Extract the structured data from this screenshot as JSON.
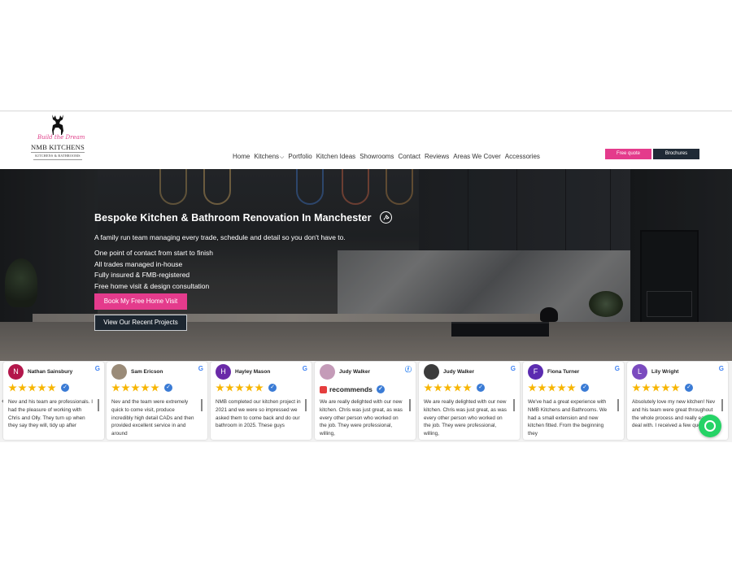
{
  "logo": {
    "script": "Build the Dream",
    "name": "NMB KITCHENS",
    "sub": "KITCHENS & BATHROOMS"
  },
  "nav": {
    "items": [
      "Home",
      "Kitchens",
      "Portfolio",
      "Kitchen Ideas",
      "Showrooms",
      "Contact",
      "Reviews",
      "Areas We Cover",
      "Accessories"
    ]
  },
  "header_buttons": {
    "free_quote": "Free quote",
    "brochures": "Brochures"
  },
  "hero": {
    "title": "Bespoke Kitchen & Bathroom Renovation In Manchester",
    "subtitle": "A family run team managing every trade, schedule and detail so you don't have to.",
    "bullets": [
      "One point of contact from start to finish",
      "All trades managed in-house",
      "Fully insured & FMB-registered",
      "Free home visit & design consultation"
    ],
    "btn_primary": "Book My Free Home Visit",
    "btn_secondary": "View Our Recent Projects"
  },
  "reviews": {
    "recommends_label": "recommends",
    "items": [
      {
        "name": "Nathan Sainsbury",
        "initial": "N",
        "avatar_color": "#b3174b",
        "source": "google",
        "text": "Nev and his team are professionals. I had the pleasure of working with Chris and Olly. They turn up when they say they will, tidy up after"
      },
      {
        "name": "Sam Ericson",
        "initial": "",
        "avatar_color": "#9a8b78",
        "source": "google",
        "text": "Nev and the team were extremely quick to come visit, produce incredibly high detail CADs and then provided excellent service in and around"
      },
      {
        "name": "Hayley Mason",
        "initial": "H",
        "avatar_color": "#6a2aa8",
        "source": "google",
        "text": "NMB completed our kitchen project in 2021 and we were so impressed we asked them to come back and do our bathroom in 2025. These guys"
      },
      {
        "name": "Judy Walker",
        "initial": "",
        "avatar_color": "#c49bb8",
        "source": "facebook",
        "text": "We are really delighted with our new kitchen. Chris was just great, as was every other person who worked on the job. They were professional, willing,"
      },
      {
        "name": "Judy Walker",
        "initial": "",
        "avatar_color": "#3b3b3b",
        "source": "google",
        "text": "We are really delighted with our new kitchen. Chris was just great, as was every other person who worked on the job. They were professional, willing,"
      },
      {
        "name": "Fiona Turner",
        "initial": "F",
        "avatar_color": "#5b2bb0",
        "source": "google",
        "text": "We've had a great experience with NMB Kitchens and Bathrooms. We had a small extension and new kitchen fitted. From the beginning they"
      },
      {
        "name": "Lily Wright",
        "initial": "L",
        "avatar_color": "#7b4bbf",
        "source": "google",
        "text": "Absolutely love my new kitchen! Nev and his team were great throughout the whole process and really easy to deal with. I received a few quotes but"
      }
    ]
  },
  "colors": {
    "brand_pink": "#e43b8c",
    "brand_dark": "#1f2a36",
    "star": "#f7b500",
    "verified": "#3a7bd5",
    "whatsapp": "#25d366"
  },
  "icons": {
    "hero_title_icon": "chat-bubble-icon",
    "whatsapp": "whatsapp-icon"
  }
}
